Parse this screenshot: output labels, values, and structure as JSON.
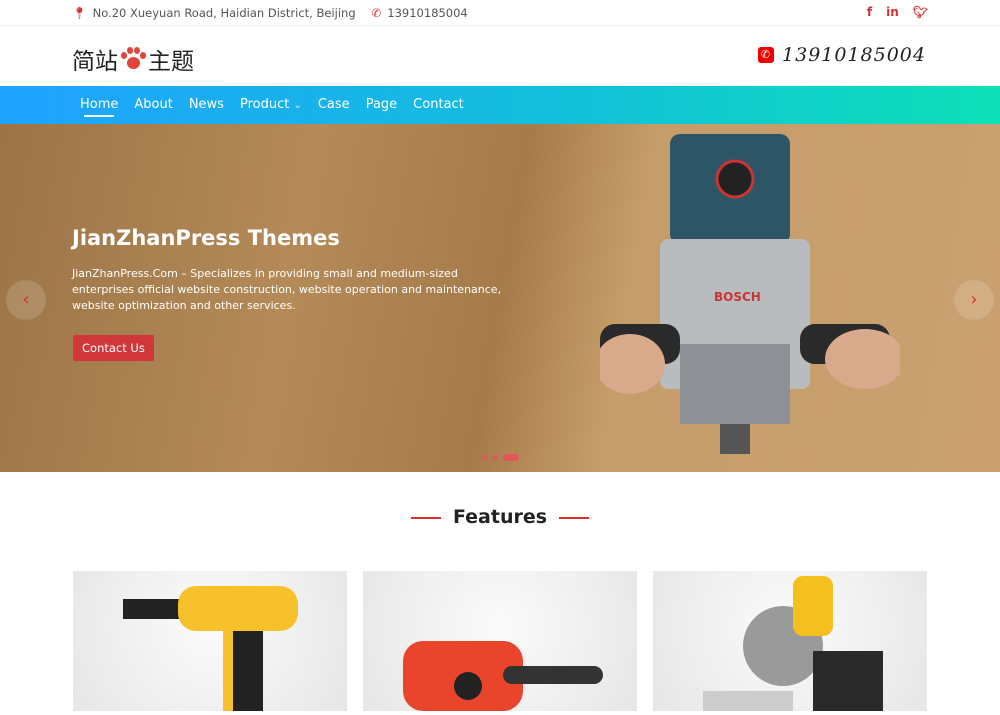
{
  "topbar": {
    "address": "No.20 Xueyuan Road, Haidian District, Beijing",
    "phone": "13910185004",
    "social": [
      "f",
      "in",
      "twitter"
    ]
  },
  "header": {
    "logo_left": "简站",
    "logo_right": "主题",
    "phone": "13910185004"
  },
  "nav": {
    "items": [
      {
        "label": "Home"
      },
      {
        "label": "About"
      },
      {
        "label": "News"
      },
      {
        "label": "Product",
        "chevron": "⌄"
      },
      {
        "label": "Case"
      },
      {
        "label": "Page"
      },
      {
        "label": "Contact"
      }
    ]
  },
  "hero": {
    "title": "JianZhanPress Themes",
    "text": "JianZhanPress.Com – Specializes in providing small and medium-sized enterprises official website construction, website operation and maintenance, website optimization and other services.",
    "button": "Contact Us",
    "prev": "‹",
    "next": "›",
    "brand": "BOSCH",
    "active_slide": 3,
    "slides": 3
  },
  "features": {
    "title": "Features"
  },
  "colors": {
    "accent": "#d9302f",
    "nav_start": "#1fa2ff",
    "nav_end": "#0de0b8"
  }
}
